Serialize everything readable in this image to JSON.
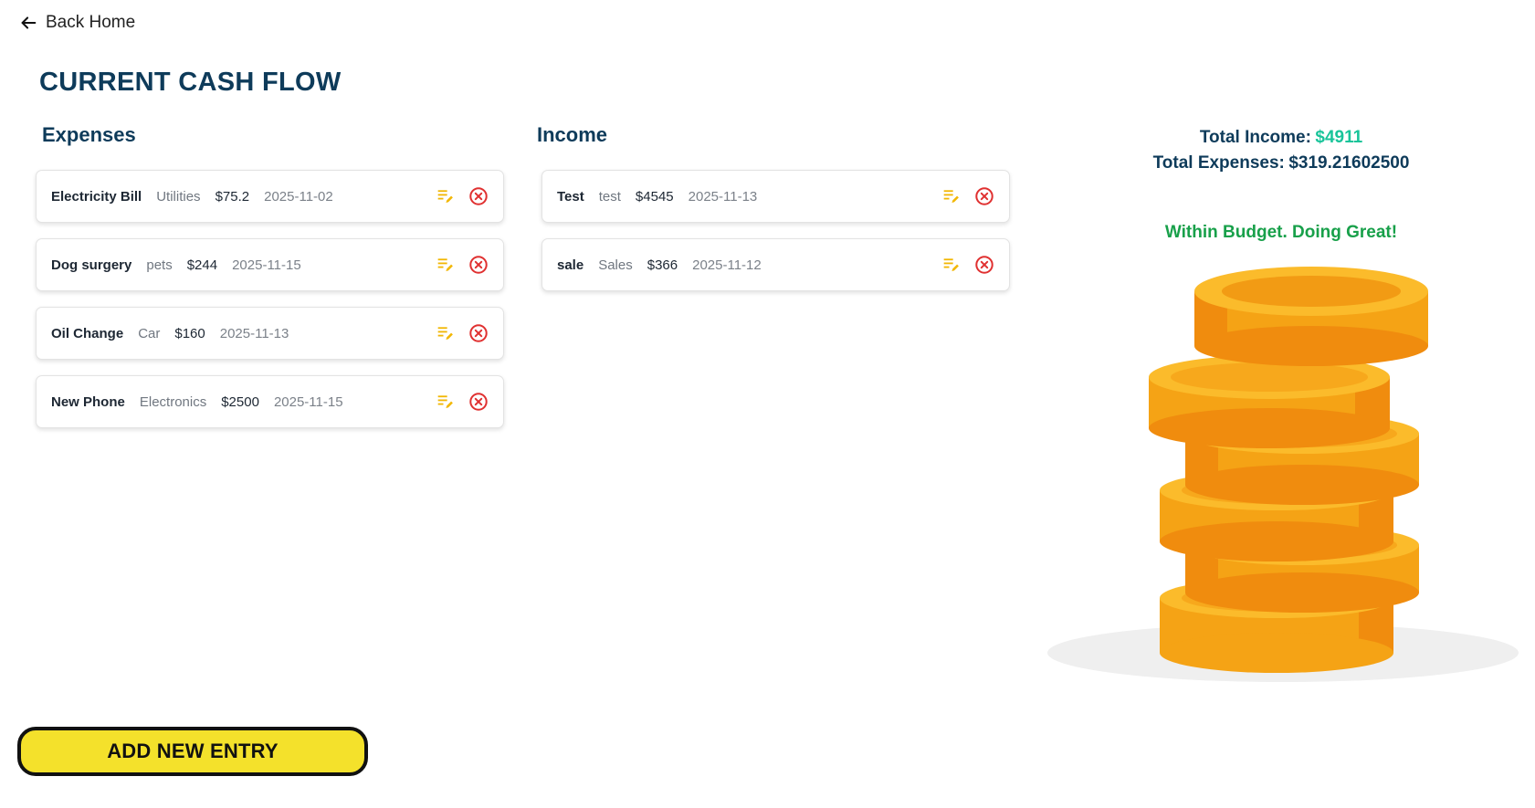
{
  "nav": {
    "back_label": "Back Home"
  },
  "page_title": "CURRENT CASH FLOW",
  "expenses": {
    "title": "Expenses",
    "items": [
      {
        "name": "Electricity Bill",
        "category": "Utilities",
        "amount": "$75.2",
        "date": "2025-11-02"
      },
      {
        "name": "Dog surgery",
        "category": "pets",
        "amount": "$244",
        "date": "2025-11-15"
      },
      {
        "name": "Oil Change",
        "category": "Car",
        "amount": "$160",
        "date": "2025-11-13"
      },
      {
        "name": "New Phone",
        "category": "Electronics",
        "amount": "$2500",
        "date": "2025-11-15"
      }
    ]
  },
  "income": {
    "title": "Income",
    "items": [
      {
        "name": "Test",
        "category": "test",
        "amount": "$4545",
        "date": "2025-11-13"
      },
      {
        "name": "sale",
        "category": "Sales",
        "amount": "$366",
        "date": "2025-11-12"
      }
    ]
  },
  "summary": {
    "income_label": "Total Income:",
    "income_value": "$4911",
    "expenses_label": "Total Expenses:",
    "expenses_value": "$319.21602500",
    "status": "Within Budget. Doing Great!"
  },
  "add_button_label": "ADD NEW ENTRY",
  "icons": {
    "back": "arrow-left-icon",
    "edit": "edit-note-icon",
    "delete": "close-circle-icon"
  },
  "colors": {
    "primary": "#0e3b5a",
    "income_value": "#19c49a",
    "status": "#18a04a",
    "edit": "#f2b705",
    "delete": "#e03131",
    "button": "#f4e12b"
  }
}
